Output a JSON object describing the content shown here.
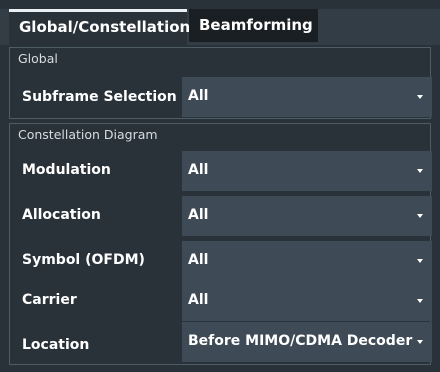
{
  "tabs": [
    {
      "label": "Global/Constellation",
      "active": true
    },
    {
      "label": "Beamforming",
      "active": false
    }
  ],
  "global_section": {
    "title": "Global",
    "rows": [
      {
        "label": "Subframe Selection",
        "value": "All"
      }
    ]
  },
  "constellation_section": {
    "title": "Constellation Diagram",
    "rows": [
      {
        "label": "Modulation",
        "value": "All"
      },
      {
        "label": "Allocation",
        "value": "All"
      },
      {
        "label": "Symbol (OFDM)",
        "value": "All"
      },
      {
        "label": "Carrier",
        "value": "All"
      },
      {
        "label": "Location",
        "value": "Before MIMO/CDMA Decoder"
      }
    ]
  },
  "colors": {
    "background": "#2a3239",
    "combo": "#3e4a55",
    "tab_inactive": "#1a1f24",
    "border": "#4e5c66"
  }
}
